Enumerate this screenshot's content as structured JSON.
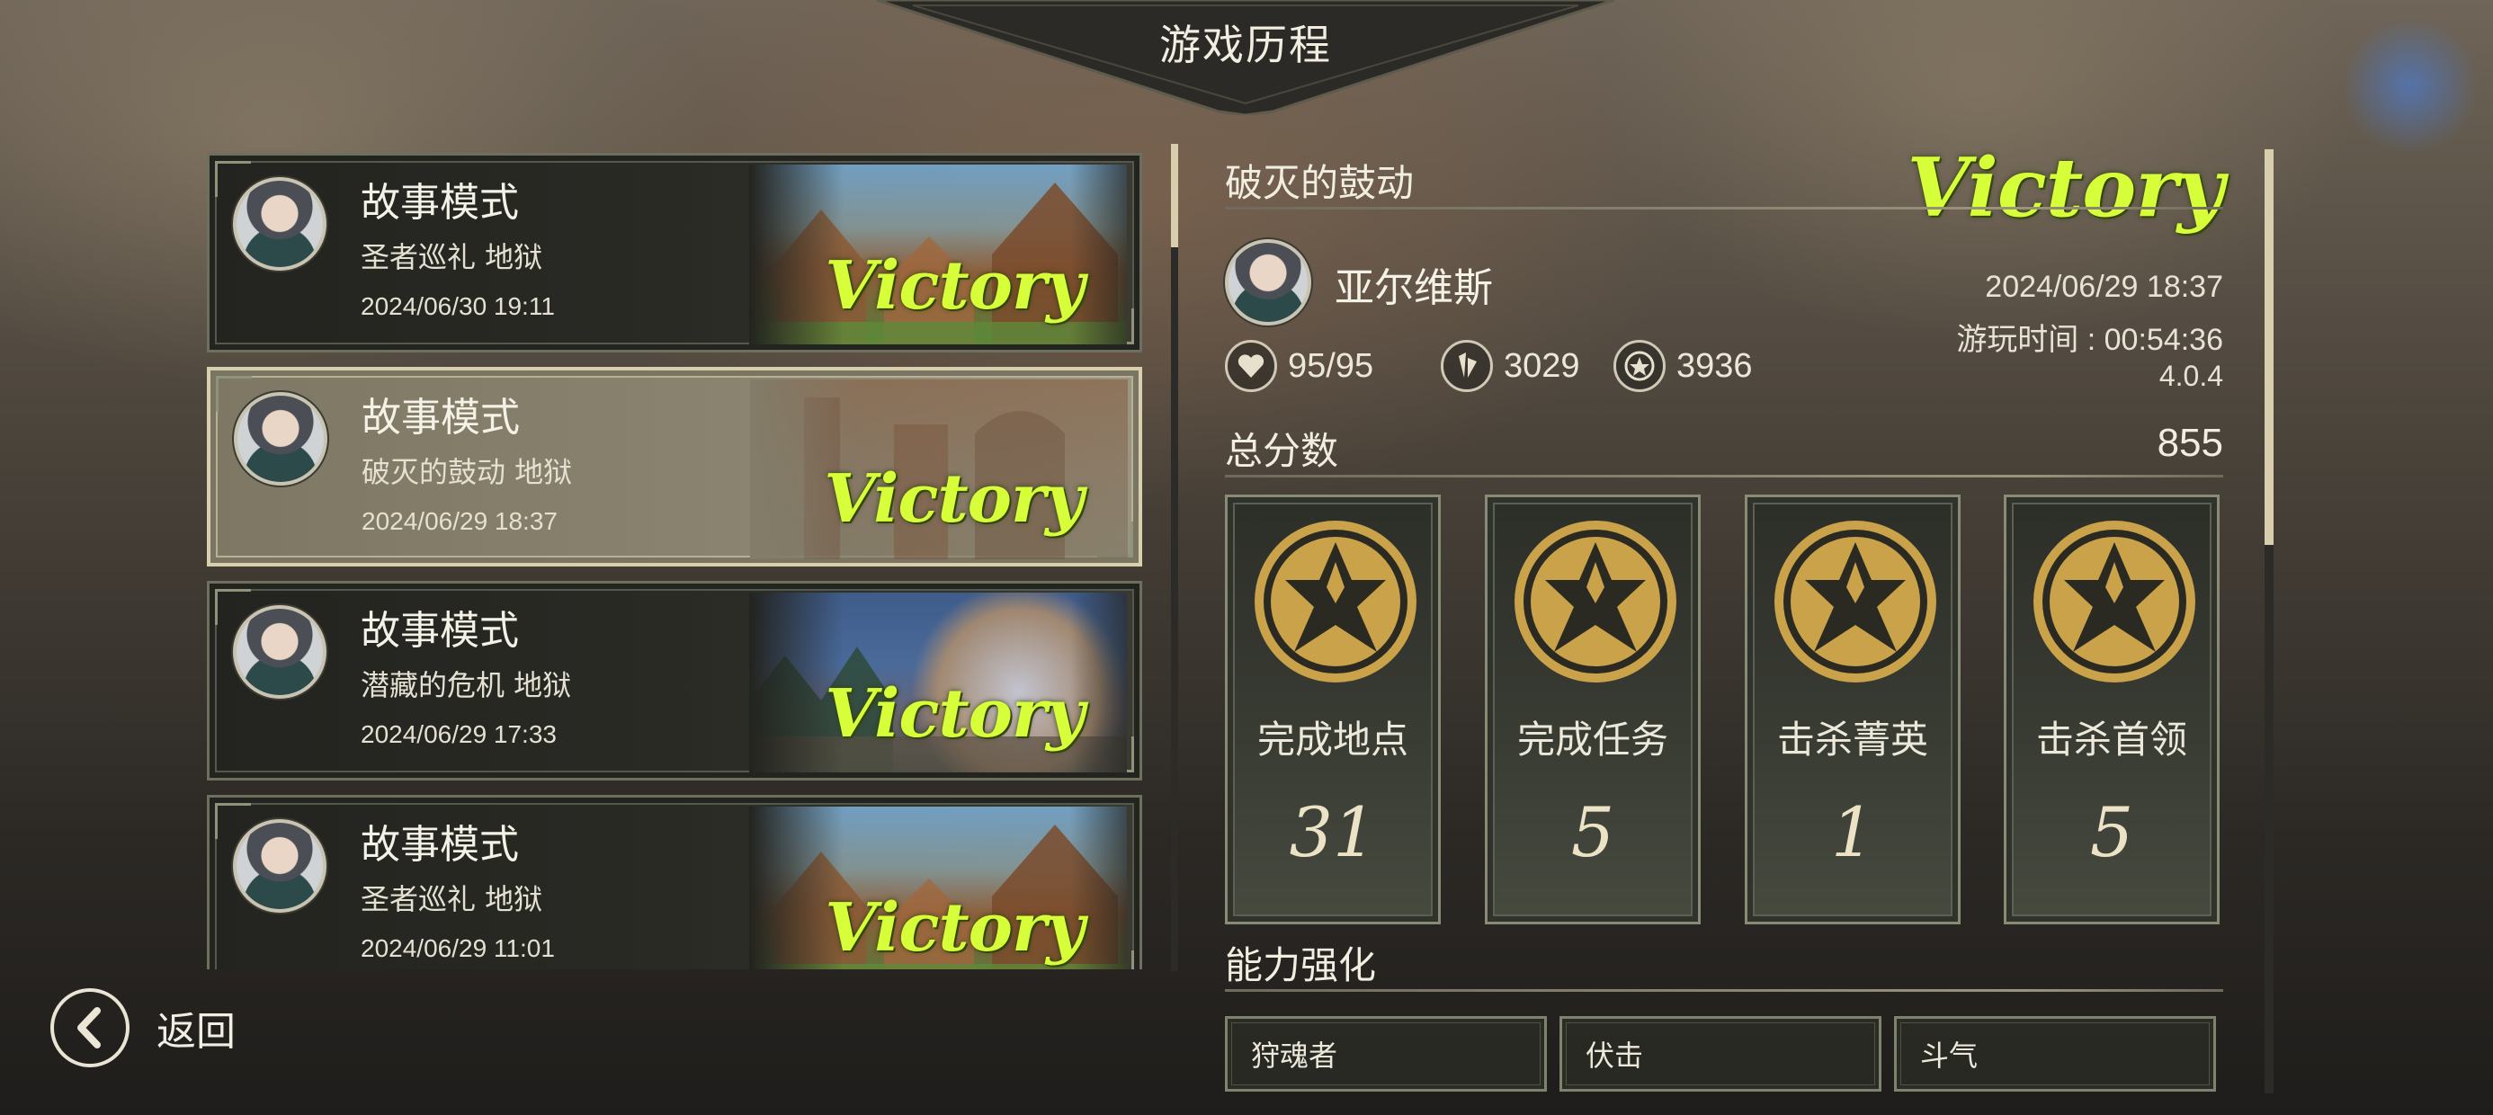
{
  "header": {
    "title": "游戏历程"
  },
  "records": [
    {
      "mode": "故事模式",
      "stage": "圣者巡礼 地狱",
      "date": "2024/06/30 19:11",
      "result": "Victory",
      "art": "town"
    },
    {
      "mode": "故事模式",
      "stage": "破灭的鼓动 地狱",
      "date": "2024/06/29 18:37",
      "result": "Victory",
      "art": "dusk",
      "selected": true
    },
    {
      "mode": "故事模式",
      "stage": "潜藏的危机 地狱",
      "date": "2024/06/29 17:33",
      "result": "Victory",
      "art": "night"
    },
    {
      "mode": "故事模式",
      "stage": "圣者巡礼 地狱",
      "date": "2024/06/29 11:01",
      "result": "Victory",
      "art": "town"
    }
  ],
  "back": {
    "label": "返回",
    "icon": "chevron-left-icon"
  },
  "detail": {
    "stage_title": "破灭的鼓动",
    "result": "Victory",
    "character": "亚尔维斯",
    "datetime": "2024/06/29 18:37",
    "playtime": "游玩时间 : 00:54:36",
    "version": "4.0.4",
    "stats": [
      {
        "icon": "heart-icon",
        "value": "95/95"
      },
      {
        "icon": "crystal-icon",
        "value": "3029"
      },
      {
        "icon": "star-coin-icon",
        "value": "3936"
      }
    ],
    "score_label": "总分数",
    "score": "855",
    "achievements": [
      {
        "label": "完成地点",
        "value": "31"
      },
      {
        "label": "完成任务",
        "value": "5"
      },
      {
        "label": "击杀菁英",
        "value": "1"
      },
      {
        "label": "击杀首领",
        "value": "5"
      }
    ],
    "abilities_label": "能力强化",
    "abilities": [
      "狩魂者",
      "伏击",
      "斗气"
    ]
  },
  "colors": {
    "victory": "#d6ff3a",
    "gold": "#c9a24a",
    "frame": "#6c705d",
    "selected_frame": "#d8cfae"
  }
}
